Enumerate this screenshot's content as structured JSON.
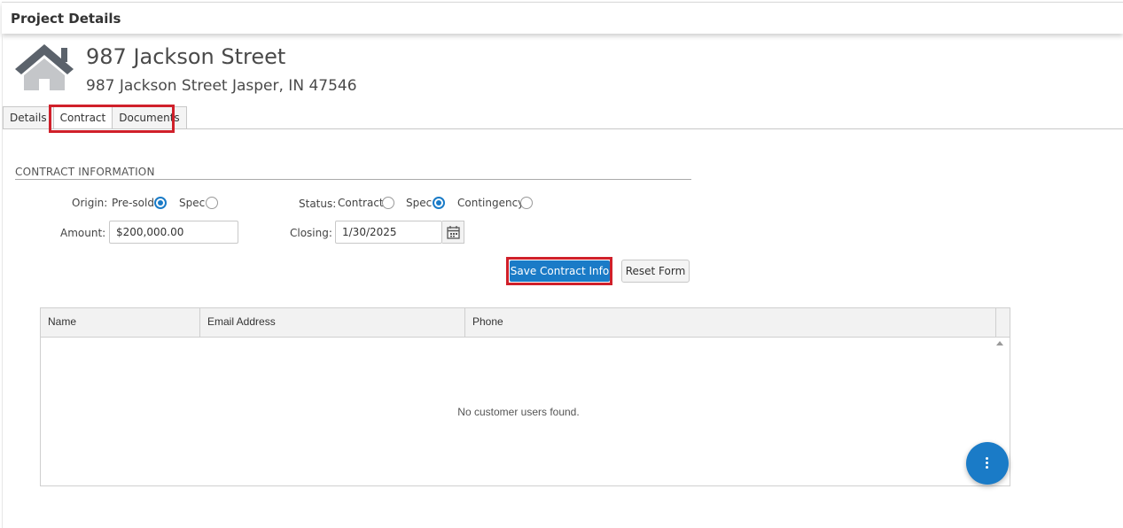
{
  "header": {
    "title": "Project Details"
  },
  "property": {
    "icon": "house-icon",
    "name": "987 Jackson Street",
    "address": "987 Jackson Street Jasper, IN 47546"
  },
  "tabs": [
    {
      "label": "Details",
      "active": false
    },
    {
      "label": "Contract",
      "active": true
    },
    {
      "label": "Documents",
      "active": false
    }
  ],
  "contract": {
    "section_title": "CONTRACT INFORMATION",
    "origin": {
      "label": "Origin:",
      "options": [
        {
          "label": "Pre-sold",
          "selected": true
        },
        {
          "label": "Spec",
          "selected": false
        }
      ]
    },
    "status": {
      "label": "Status:",
      "options": [
        {
          "label": "Contract",
          "selected": false
        },
        {
          "label": "Spec",
          "selected": true
        },
        {
          "label": "Contingency",
          "selected": false
        }
      ]
    },
    "amount": {
      "label": "Amount:",
      "value": "$200,000.00"
    },
    "closing": {
      "label": "Closing:",
      "value": "1/30/2025",
      "icon": "calendar-icon"
    },
    "save_label": "Save Contract Info",
    "reset_label": "Reset Form"
  },
  "grid": {
    "columns": [
      "Name",
      "Email Address",
      "Phone"
    ],
    "empty_message": "No customer users found."
  },
  "fab": {
    "icon": "more-vertical-icon"
  },
  "colors": {
    "accent": "#1a7bc7",
    "highlight": "#d0202a"
  }
}
